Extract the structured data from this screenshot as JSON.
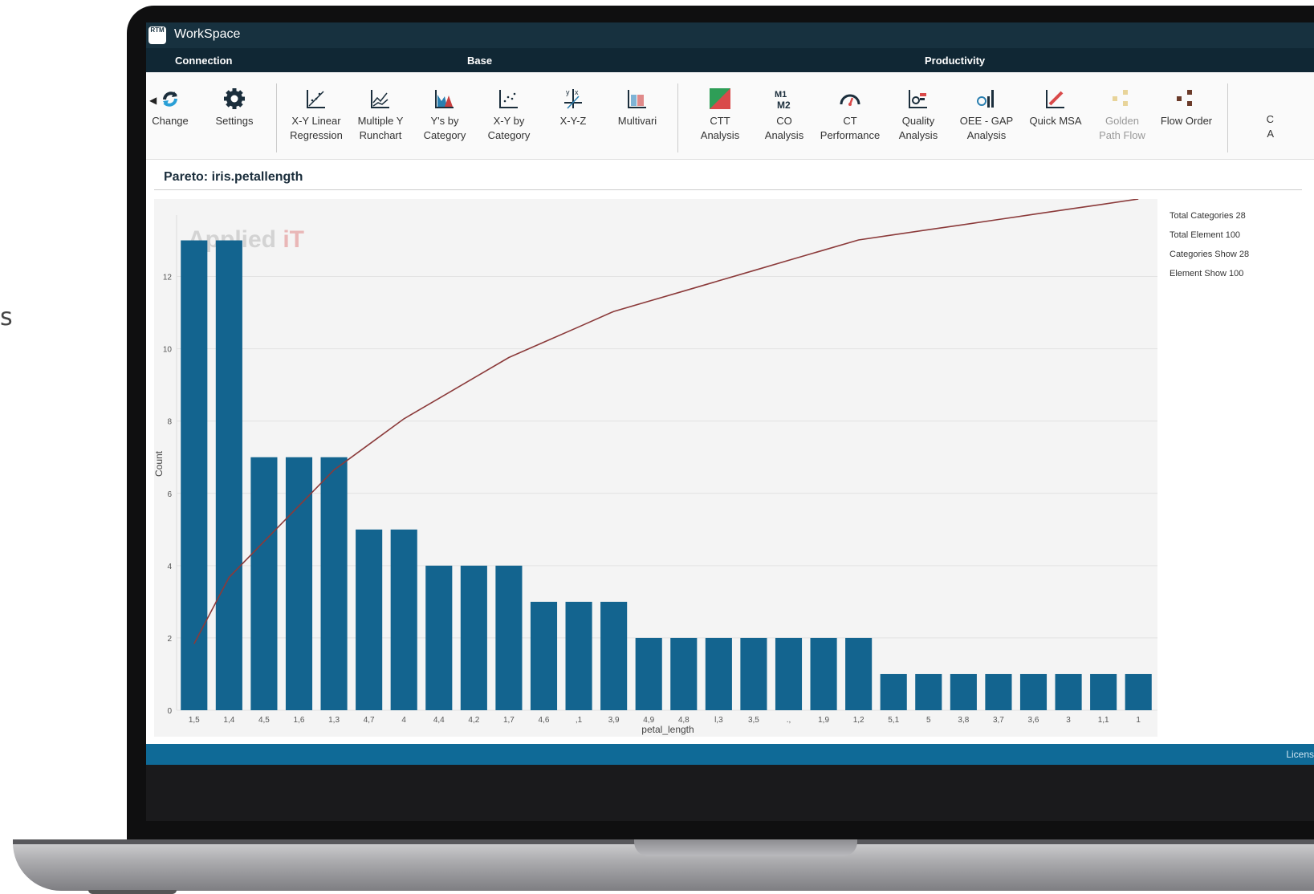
{
  "edge_text": "s",
  "app": {
    "title": "WorkSpace",
    "logo_text": "RTM"
  },
  "groups": {
    "connection": "Connection",
    "base": "Base",
    "productivity": "Productivity"
  },
  "ribbon": {
    "change": "Change",
    "settings": "Settings",
    "xy_linear": "X-Y Linear\nRegression",
    "multiple_y": "Multiple Y\nRunchart",
    "ys_by_category": "Y's by\nCategory",
    "xy_by_category": "X-Y by\nCategory",
    "xyz": "X-Y-Z",
    "multivari": "Multivari",
    "ctt": "CTT\nAnalysis",
    "co": "CO\nAnalysis",
    "ct_perf": "CT\nPerformance",
    "quality": "Quality\nAnalysis",
    "oee": "OEE - GAP\nAnalysis",
    "quick_msa": "Quick MSA",
    "golden": "Golden\nPath Flow",
    "flow_order": "Flow Order",
    "cut_label": "C\nA"
  },
  "panel": {
    "title": "Pareto: iris.petallength"
  },
  "watermark": "Applied iT",
  "stats": {
    "total_categories": "Total Categories 28",
    "total_element": "Total Element 100",
    "categories_show": "Categories Show 28",
    "element_show": "Element Show 100"
  },
  "status": {
    "license": "Licens"
  },
  "colors": {
    "bar": "#13648f",
    "line": "#8b3a3a",
    "titlebar": "#17313f",
    "statusbar": "#0f6a97"
  },
  "chart_data": {
    "type": "bar",
    "categories": [
      "1,5",
      "1,4",
      "4,5",
      "1,6",
      "1,3",
      "4,7",
      "4",
      "4,4",
      "4,2",
      "1,7",
      "4,6",
      "4,1",
      "3,9",
      "4,9",
      "4,8",
      "3,3",
      "3,5",
      "5,2",
      "1,9",
      "1,2",
      "5,1",
      "5",
      "3,8",
      "3,7",
      "3,6",
      "3",
      "1,1",
      "1"
    ],
    "tick_labels_shown": [
      "1,5",
      "1,4",
      "4,5",
      "1,6",
      "1,3",
      "4,7",
      "4",
      "4,4",
      "4,2",
      "1,7",
      "4,6",
      ",1",
      "3,9",
      "4,9",
      "4,8",
      "l,3",
      "3,5",
      ".,",
      "1,9",
      "1,2",
      "5,1",
      "5",
      "3,8",
      "3,7",
      "3,6",
      "3",
      "1,1",
      "1"
    ],
    "values": [
      13,
      13,
      7,
      7,
      7,
      5,
      5,
      4,
      4,
      4,
      3,
      3,
      3,
      2,
      2,
      2,
      2,
      2,
      2,
      2,
      1,
      1,
      1,
      1,
      1,
      1,
      1,
      1
    ],
    "cumulative_line": true,
    "xlabel": "petal_length",
    "ylabel": "Count",
    "ylim": [
      0,
      13.7
    ],
    "yticks": [
      "0",
      "2",
      "4",
      "6",
      "8",
      "10",
      "12"
    ],
    "grid": true
  }
}
